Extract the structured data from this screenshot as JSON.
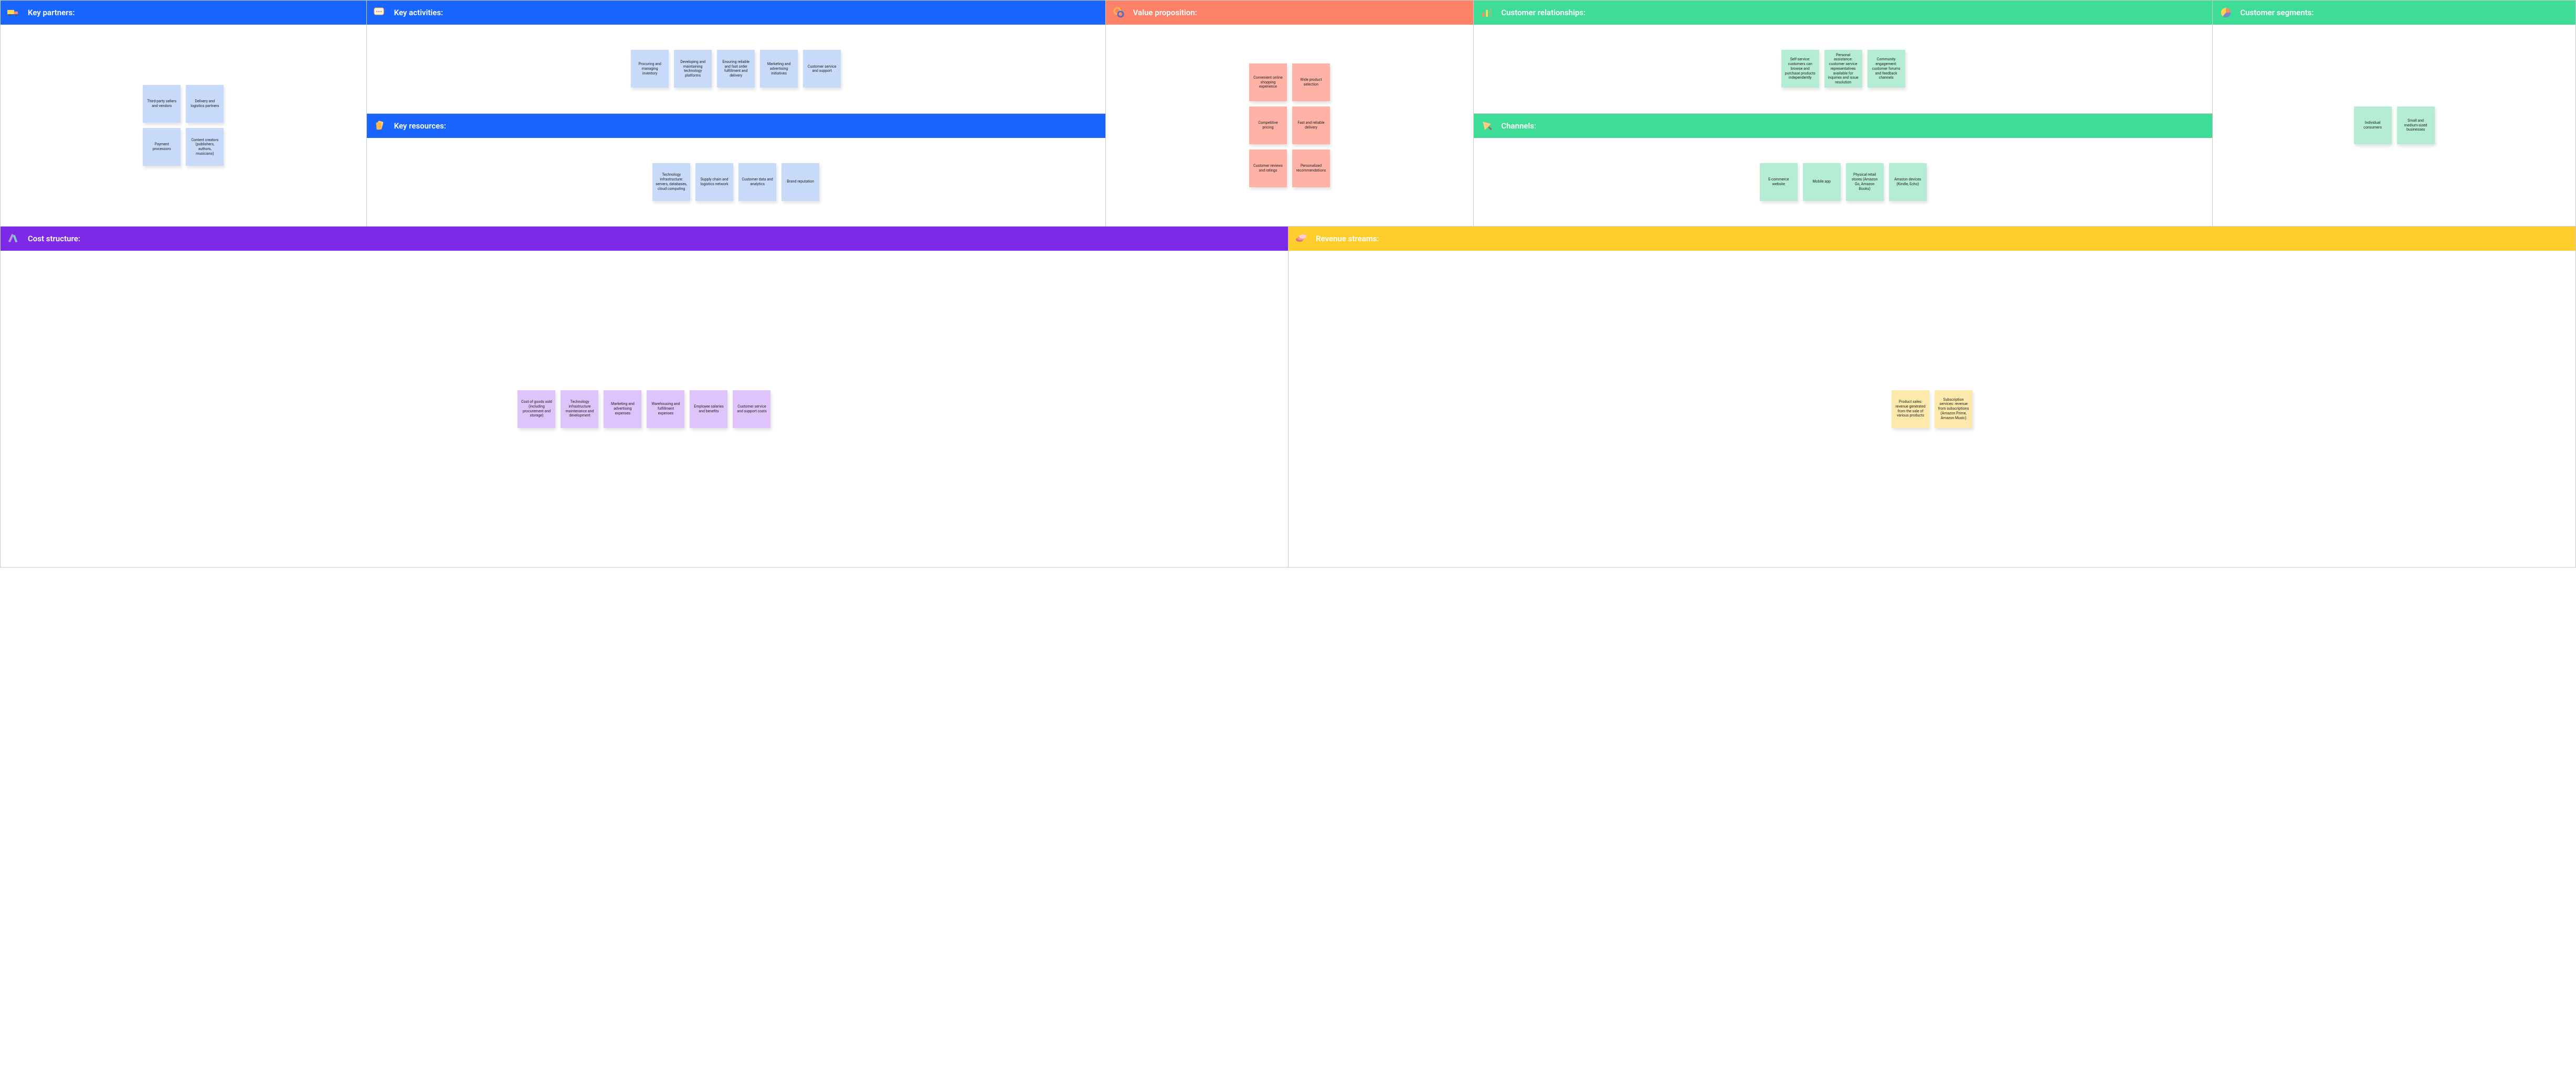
{
  "sections": {
    "key_partners": {
      "title": "Key partners:",
      "notes": [
        "Third-party sellers and vendors",
        "Delivery and logistics partners",
        "Payment processors",
        "Content creators (publishers, authors, musicians)"
      ]
    },
    "key_activities": {
      "title": "Key activities:",
      "notes": [
        "Procuring and managing inventory",
        "Developing and maintaining technology platforms",
        "Ensuring reliable and fast order fulfillment and delivery",
        "Marketing and advertising initiatives",
        "Customer service and support"
      ]
    },
    "key_resources": {
      "title": "Key resources:",
      "notes": [
        "Technology infrastructure: servers, databases, cloud computing",
        "Supply chain and logistics network",
        "Customer data and analytics",
        "Brand reputation"
      ]
    },
    "value_proposition": {
      "title": "Value proposition:",
      "notes": [
        "Convenient online shopping experience",
        "Wide product selection",
        "Competitive pricing",
        "Fast and reliable delivery",
        "Customer reviews and ratings",
        "Personalized recommendations"
      ]
    },
    "customer_relationships": {
      "title": "Customer relationships:",
      "notes": [
        "Self-service: customers can browse and purchase products independently",
        "Personal assistance: customer service representatives available for inquiries and issue resolution",
        "Community engagement: customer forums and feedback channels"
      ]
    },
    "channels": {
      "title": "Channels:",
      "notes": [
        "E-commerce website",
        "Mobile app",
        "Physical retail stores (Amazon Go, Amazon Books)",
        "Amazon devices (Kindle, Echo)"
      ]
    },
    "customer_segments": {
      "title": "Customer segments:",
      "notes": [
        "Individual consumers",
        "Small and medium-sized businesses"
      ]
    },
    "cost_structure": {
      "title": "Cost structure:",
      "notes": [
        "Cost of goods sold (including procurement and storage)",
        "Technology infrastructure maintenance and development",
        "Marketing and advertising expenses",
        "Warehousing and fulfillment expenses",
        "Employee salaries and benefits",
        "Customer service and support costs"
      ]
    },
    "revenue_streams": {
      "title": "Revenue streams:",
      "notes": [
        "Product sales: revenue generated from the sale of various products",
        "Subscription services: revenue from subscriptions (Amazon Prime, Amazon Music)"
      ]
    }
  }
}
